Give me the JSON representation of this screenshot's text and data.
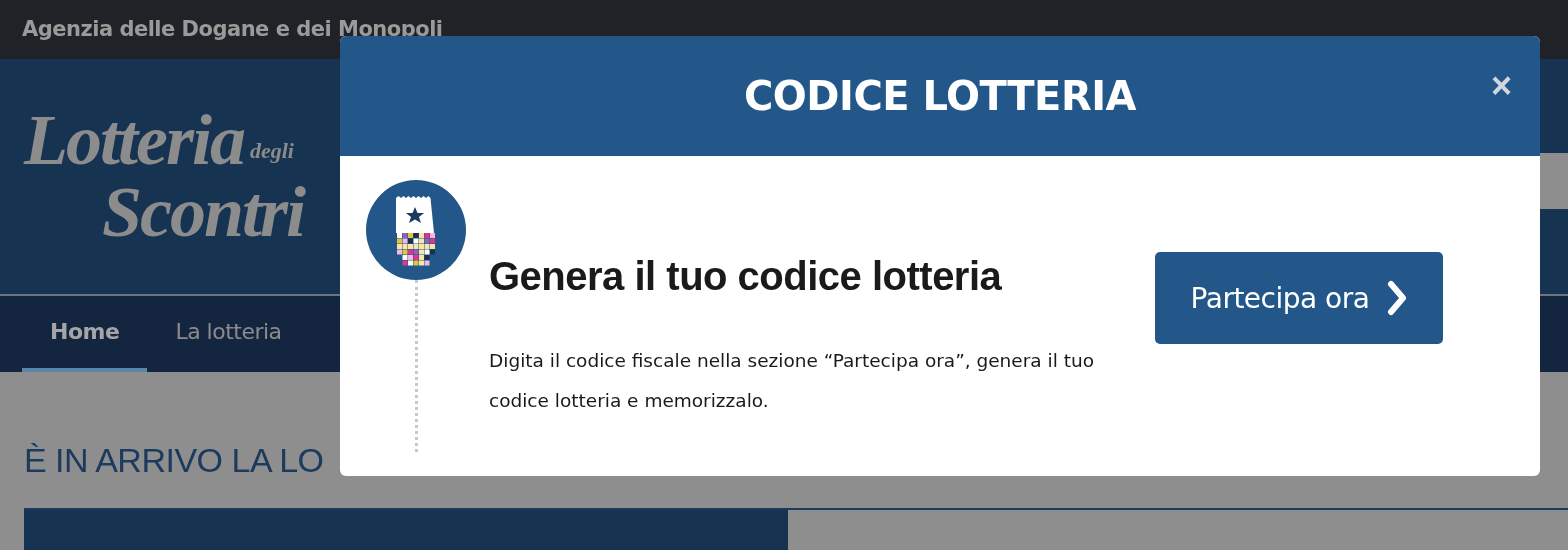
{
  "top_bar": {
    "title": "Agenzia delle Dogane e dei Monopoli"
  },
  "logo": {
    "line_1": "Lotteria",
    "small": "degli",
    "line_2": "Scontri"
  },
  "nav": [
    {
      "label": "Home",
      "selected": true
    },
    {
      "label": "La lotteria",
      "selected": false
    }
  ],
  "page_heading": "È IN ARRIVO LA LO",
  "modal": {
    "title": "CODICE LOTTERIA",
    "close": "×",
    "step": {
      "heading": "Genera il tuo codice lotteria",
      "text": "Digita il codice fiscale nella sezione “Partecipa ora”, genera il tuo codice lotteria e memorizzalo."
    },
    "button": "Partecipa ora"
  }
}
